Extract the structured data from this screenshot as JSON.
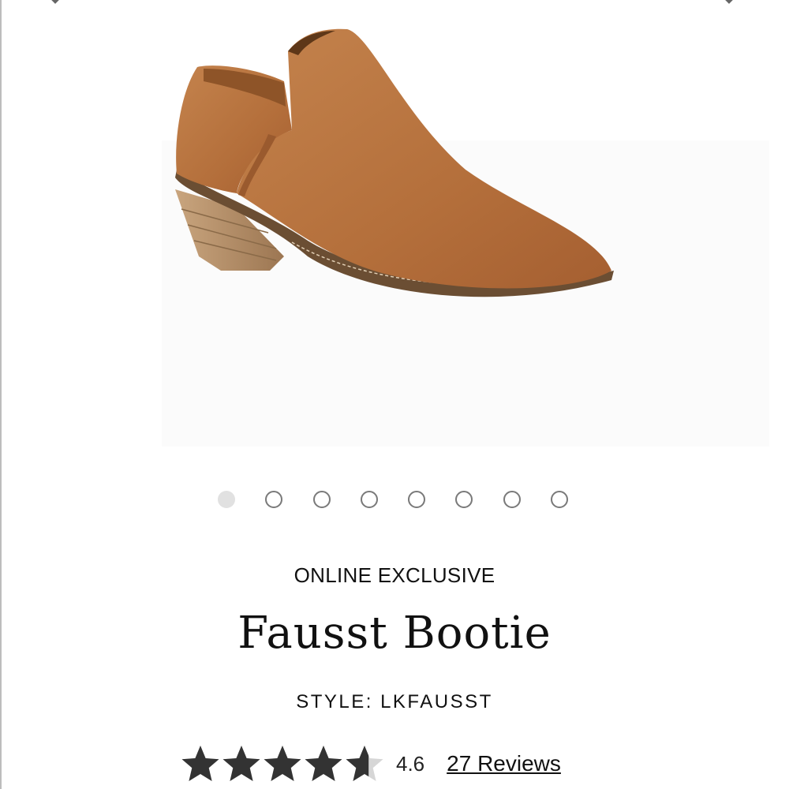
{
  "carousel": {
    "prev_icon": "chevron-left-icon",
    "next_icon": "chevron-right-icon",
    "dot_count": 8,
    "active_index": 0
  },
  "product": {
    "tag": "ONLINE EXCLUSIVE",
    "title": "Fausst Bootie",
    "style_label": "STYLE: LKFAUSST",
    "color_hex": "#b8743f"
  },
  "rating": {
    "value": "4.6",
    "stars_filled": 4.6,
    "max_stars": 5,
    "reviews_label": "27 Reviews",
    "star_color": "#333333",
    "star_empty_color": "#d6d6d6"
  }
}
